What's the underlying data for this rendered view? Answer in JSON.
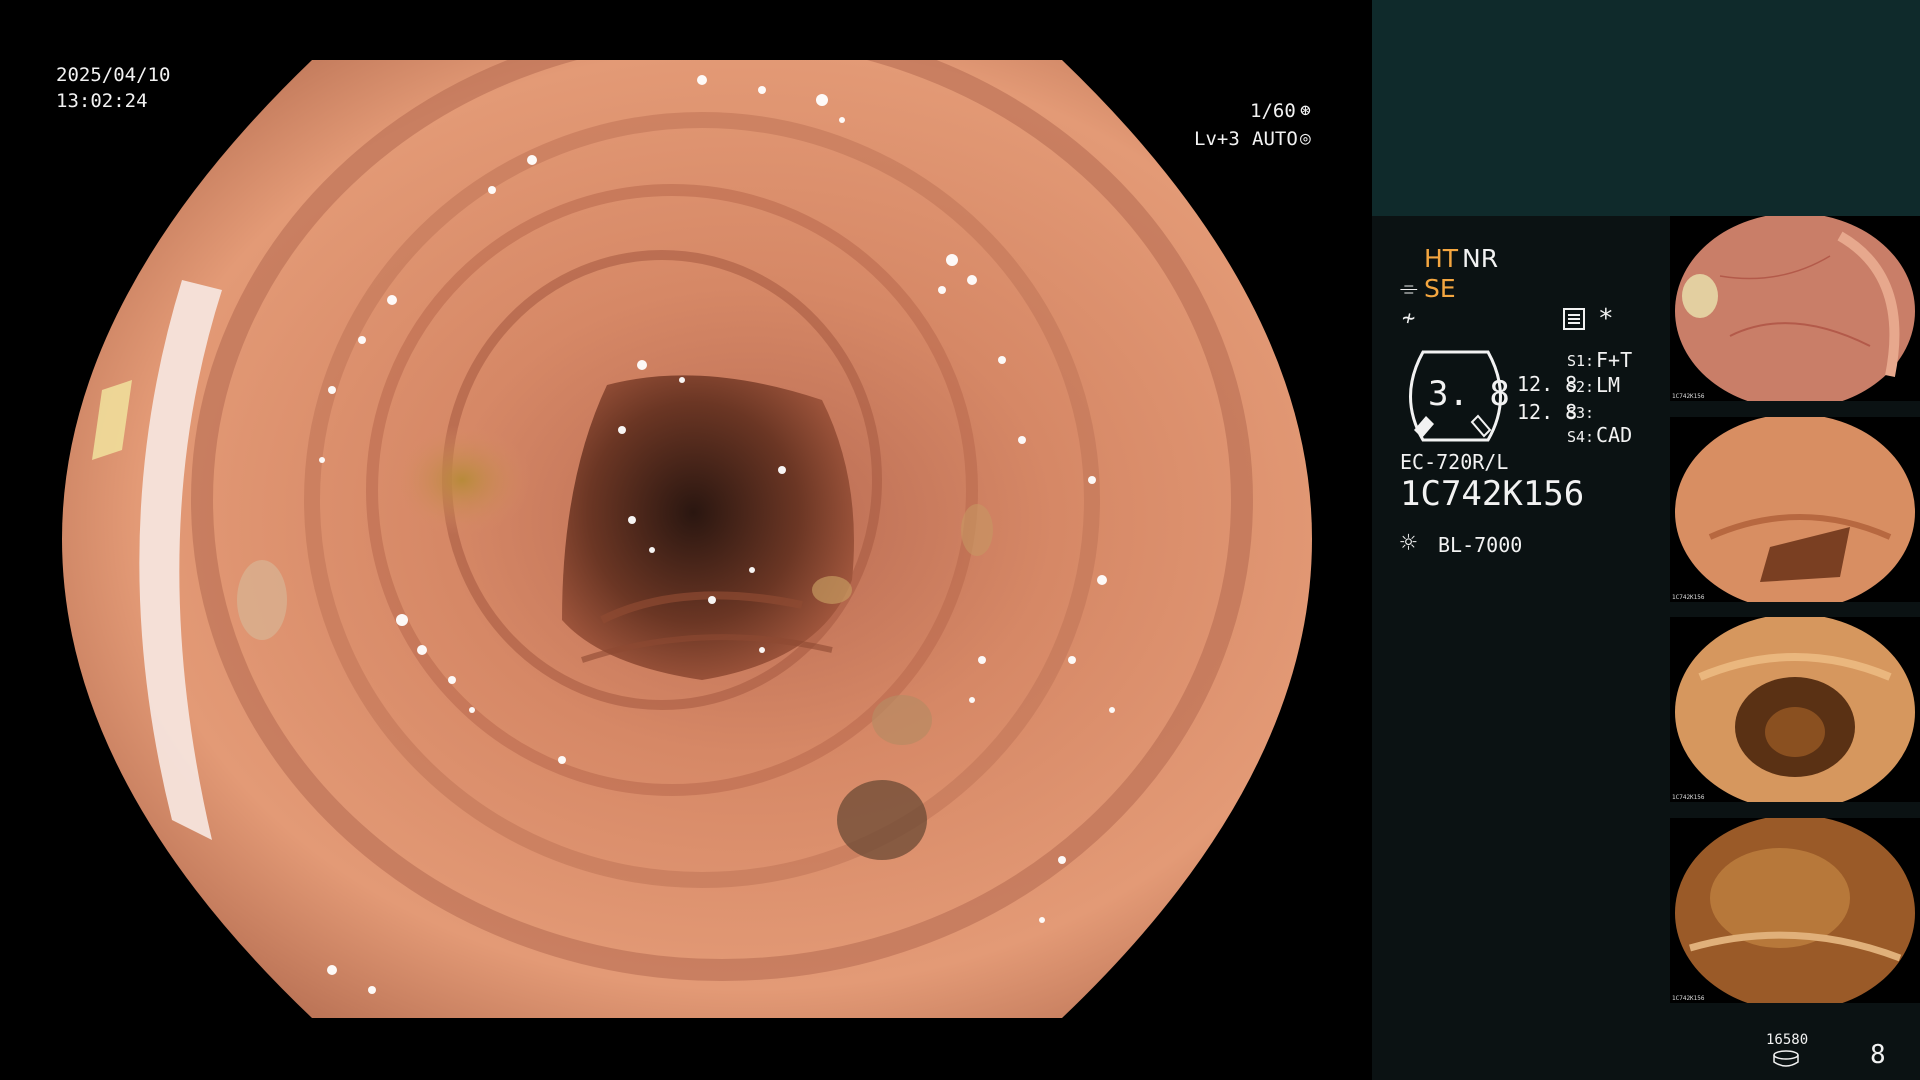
{
  "main_view": {
    "date": "2025/04/10",
    "time": "13:02:24",
    "shutter": "1/60",
    "level": "Lv+3",
    "iris_mode": "AUTO"
  },
  "panel": {
    "mode_ht": "HT",
    "mode_nr": "NR",
    "mode_se": "SE",
    "zoom_value": "3. 8",
    "side_val_1": "12. 8",
    "side_val_2": "12. 8",
    "s1_label": "S1:",
    "s1_value": "F+T",
    "s2_label": "S2:",
    "s2_value": "LM",
    "s3_label": "S3:",
    "s3_value": "",
    "s4_label": "S4:",
    "s4_value": "CAD",
    "asterisk": "*",
    "scope_model": "EC-720R/L",
    "scope_serial": "1C742K156",
    "light_source": "BL-7000",
    "storage_count": "16580",
    "image_count": "8"
  },
  "thumbnails": [
    {
      "icon": "endoscopic-image-thumbnail",
      "serial": "1C742K156"
    },
    {
      "icon": "endoscopic-image-thumbnail",
      "serial": "1C742K156"
    },
    {
      "icon": "endoscopic-image-thumbnail",
      "serial": "1C742K156"
    },
    {
      "icon": "endoscopic-image-thumbnail",
      "serial": "1C742K156"
    }
  ],
  "colors": {
    "mucosa": "#c8765a",
    "mode_highlight": "#f4a640",
    "panel_top": "#0f2a2b",
    "panel_bg": "#0b1213"
  }
}
